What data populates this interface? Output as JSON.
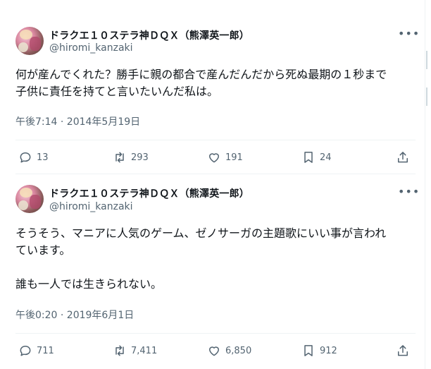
{
  "tweets": [
    {
      "display_name": "ドラクエ１０ステラ神ＤＱＸ（熊澤英一郎）",
      "handle": "@hiromi_kanzaki",
      "text": "何が産んでくれた？勝手に親の都合で産んだんだから死ぬ最期の１秒まで\n子供に責任を持てと言いたいんだ私は。",
      "timestamp": "午後7:14 · 2014年5月19日",
      "replies": "13",
      "retweets": "293",
      "likes": "191",
      "bookmarks": "24"
    },
    {
      "display_name": "ドラクエ１０ステラ神ＤＱＸ（熊澤英一郎）",
      "handle": "@hiromi_kanzaki",
      "text": "そうそう、マニアに人気のゲーム、ゼノサーガの主題歌にいい事が言われ\nています。\n\n誰も一人では生きられない。",
      "timestamp": "午後0:20 · 2019年6月1日",
      "replies": "711",
      "retweets": "7,411",
      "likes": "6,850",
      "bookmarks": "912"
    }
  ],
  "icons": {
    "more": "more-icon",
    "reply": "reply-icon",
    "retweet": "retweet-icon",
    "like": "like-icon",
    "bookmark": "bookmark-icon",
    "share": "share-icon"
  },
  "colors": {
    "text": "#0f1419",
    "secondary": "#536471",
    "divider": "#eff3f4"
  }
}
